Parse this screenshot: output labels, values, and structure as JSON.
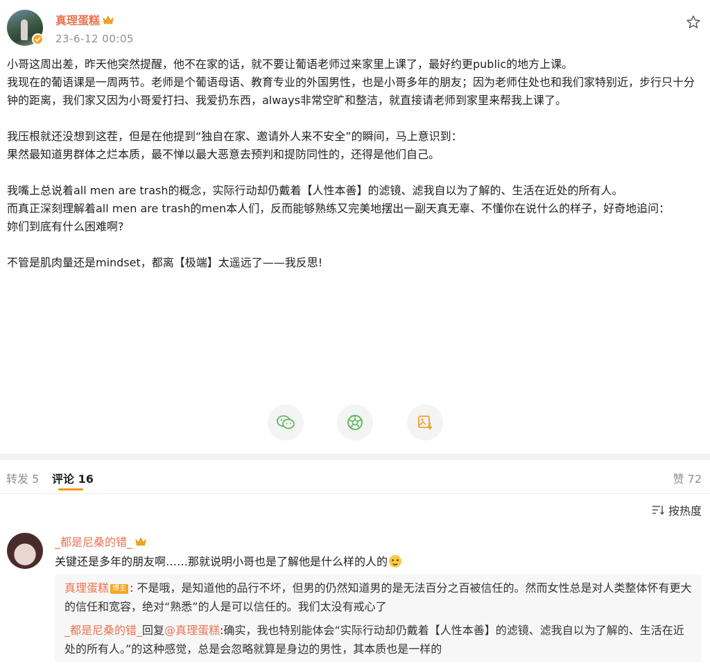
{
  "post": {
    "username": "真理蛋糕",
    "timestamp": "23-6-12 00:05",
    "paragraphs": [
      "小哥这周出差，昨天他突然提醒，他不在家的话，就不要让葡语老师过来家里上课了，最好约更public的地方上课。\n我现在的葡语课是一周两节。老师是个葡语母语、教育专业的外国男性，也是小哥多年的朋友；因为老师住处也和我们家特别近，步行只十分钟的距离，我们家又因为小哥爱打扫、我爱扔东西，always非常空旷和整洁，就直接请老师到家里来帮我上课了。",
      "我压根就还没想到这茬，但是在他提到“独自在家、邀请外人来不安全”的瞬间，马上意识到：\n果然最知道男群体之烂本质，最不惮以最大恶意去预判和提防同性的，还得是他们自己。",
      "我嘴上总说着all men are trash的概念，实际行动却仍戴着【人性本善】的滤镜、滤我自以为了解的、生活在近处的所有人。\n而真正深刻理解着all men are trash的men本人们，反而能够熟练又完美地摆出一副天真无辜、不懂你在说什么的样子，好奇地追问：\n妳们到底有什么困难啊?",
      "不管是肌肉量还是mindset，都离【极端】太遥远了——我反思!"
    ]
  },
  "share_icons": [
    "wechat-icon",
    "moments-icon",
    "save-image-icon"
  ],
  "tabs": {
    "repost": "转发 5",
    "comments": "评论 16",
    "likes": "赞 72"
  },
  "sort": {
    "label": "按热度"
  },
  "comment": {
    "username": "_都是尼桑的错_",
    "text": "关键还是多年的朋友啊……那就说明小哥也是了解他是什么样的人的",
    "replies": [
      {
        "name": "真理蛋糕",
        "badge": "博主",
        "text": ": 不是哦，是知道他的品行不坏，但男的仍然知道男的是无法百分之百被信任的。然而女性总是对人类整体怀有更大的信任和宽容，绝对“熟悉”的人是可以信任的。我们太没有戒心了"
      },
      {
        "name": "_都是尼桑的错_",
        "reply_word": "回复",
        "mention": "@真理蛋糕",
        "text": ":确实，我也特别能体会“实际行动却仍戴着【人性本善】的滤镜、滤我自以为了解的、生活在近处的所有人。”的这种感觉，总是会忽略就算是身边的男性，其本质也是一样的"
      }
    ]
  },
  "colors": {
    "accent": "#eb7350",
    "tab_underline": "#f39800",
    "gold": "#f5a623"
  }
}
